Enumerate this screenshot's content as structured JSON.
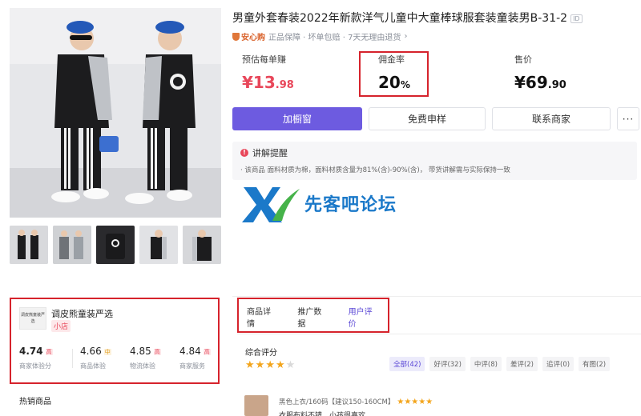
{
  "product": {
    "title": "男童外套春装2022年新款洋气儿童中大童棒球服套装童装男B-31-2",
    "id_tag": "ID",
    "guarantee_brand": "安心购",
    "guarantee_text": "正品保障 · 坏单包赔 · 7天无理由退货",
    "guarantee_chevron": "›"
  },
  "metrics": {
    "earn_label": "预估每单赚",
    "earn_currency": "¥",
    "earn_int": "13",
    "earn_dec": ".98",
    "commission_label": "佣金率",
    "commission_value": "20",
    "commission_unit": "%",
    "price_label": "售价",
    "price_currency": "¥",
    "price_int": "69",
    "price_dec": ".90"
  },
  "actions": {
    "add_window": "加橱窗",
    "free_sample": "免费申样",
    "contact_merchant": "联系商家",
    "more": "···"
  },
  "notice": {
    "title": "讲解提醒",
    "icon": "!",
    "text": "· 该商品 面料材质为棉，面料材质含量为81%(含)-90%(含)， 带货讲解需与实际保持一致"
  },
  "watermark": {
    "logo_letters": "XR",
    "text": "先客吧论坛"
  },
  "shop": {
    "logo_text": "调皮熊童装严选",
    "name": "调皮熊童装严选",
    "tag": "小店",
    "scores": [
      {
        "value": "4.74",
        "level": "高",
        "caption": "商家体验分",
        "level_class": "lvl-high"
      },
      {
        "value": "4.66",
        "level": "中",
        "caption": "商品体验",
        "level_class": "lvl-mid"
      },
      {
        "value": "4.85",
        "level": "高",
        "caption": "物流体验",
        "level_class": "lvl-high"
      },
      {
        "value": "4.84",
        "level": "高",
        "caption": "商家服务",
        "level_class": "lvl-high"
      }
    ],
    "hot_title": "热销商品"
  },
  "tabs": {
    "items": [
      "商品详情",
      "推广数据",
      "用户评价"
    ],
    "active_index": 2
  },
  "reviews": {
    "overall_title": "综合评分",
    "overall_stars": 4,
    "filters": [
      "全部(42)",
      "好评(32)",
      "中评(8)",
      "差评(2)",
      "追评(0)",
      "有图(2)"
    ],
    "first_meta": "黑色上衣/160码【建议150-160CM】",
    "first_stars": "★★★★★",
    "first_text": "衣服布料不错，小孩很喜欢"
  },
  "colors": {
    "accent": "#6d5be0",
    "price_red": "#e8475a",
    "highlight_box": "#d6232c",
    "star": "#f3a51c"
  }
}
